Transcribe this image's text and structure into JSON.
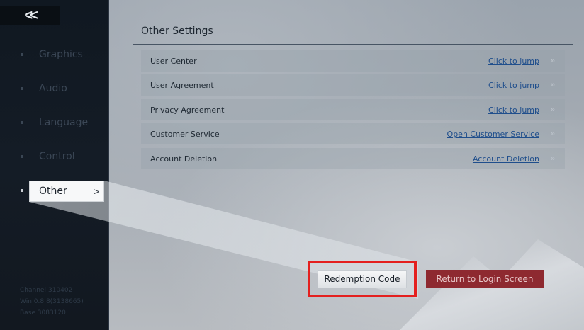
{
  "back_icon": "double-chevron-left-icon",
  "sidebar": {
    "items": [
      {
        "label": "Graphics"
      },
      {
        "label": "Audio"
      },
      {
        "label": "Language"
      },
      {
        "label": "Control"
      },
      {
        "label": "Other",
        "active": true
      }
    ],
    "active_chevron": ">",
    "version_lines": [
      "Channel:310402",
      "Win 0.8.8(3138665)",
      "Base 3083120"
    ]
  },
  "panel": {
    "title": "Other Settings",
    "rows": [
      {
        "name": "User Center",
        "link": "Click to jump"
      },
      {
        "name": "User Agreement",
        "link": "Click to jump"
      },
      {
        "name": "Privacy Agreement",
        "link": "Click to jump"
      },
      {
        "name": "Customer Service",
        "link": "Open Customer Service"
      },
      {
        "name": "Account Deletion",
        "link": "Account Deletion"
      }
    ],
    "row_arrow": "»"
  },
  "buttons": {
    "redemption": "Redemption Code",
    "return_login": "Return to Login Screen"
  },
  "colors": {
    "highlight": "#e4201f",
    "return_button": "#8e2930",
    "link": "#1f4e8c"
  }
}
